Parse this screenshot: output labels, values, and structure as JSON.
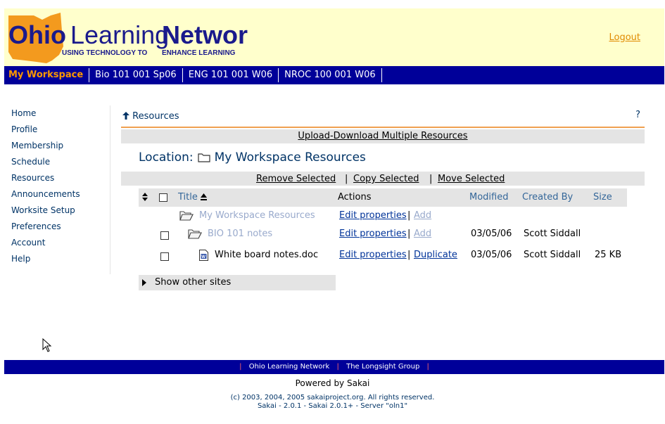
{
  "header": {
    "logo": {
      "ohio": "Ohio",
      "learning": "Learning",
      "network": "Network",
      "tagline_left": "USING TECHNOLOGY TO",
      "tagline_right": "ENHANCE LEARNING"
    },
    "logout": "Logout"
  },
  "sitenav": {
    "tabs": [
      {
        "label": "My Workspace",
        "selected": true
      },
      {
        "label": "Bio 101 001 Sp06",
        "selected": false
      },
      {
        "label": "ENG 101 001 W06",
        "selected": false
      },
      {
        "label": "NROC 100 001 W06",
        "selected": false
      }
    ]
  },
  "toolmenu": {
    "items": [
      {
        "label": "Home"
      },
      {
        "label": "Profile"
      },
      {
        "label": "Membership"
      },
      {
        "label": "Schedule"
      },
      {
        "label": "Resources"
      },
      {
        "label": "Announcements"
      },
      {
        "label": "Worksite Setup"
      },
      {
        "label": "Preferences"
      },
      {
        "label": "Account"
      },
      {
        "label": "Help"
      }
    ]
  },
  "tool": {
    "title": "Resources",
    "help": "?",
    "upload_label": "Upload-Download Multiple Resources",
    "location_label": "Location:",
    "location_value": "My Workspace Resources",
    "actions": {
      "remove": "Remove Selected",
      "copy": "Copy Selected",
      "move": "Move Selected",
      "separator": "|"
    },
    "columns": {
      "title": "Title",
      "actions": "Actions",
      "modified": "Modified",
      "created_by": "Created By",
      "size": "Size"
    },
    "rows": [
      {
        "title": "My Workspace Resources",
        "edit": "Edit properties",
        "sep": "|",
        "second": "Add",
        "modified": "",
        "created_by": "",
        "size": ""
      },
      {
        "title": "BIO 101 notes",
        "edit": "Edit properties",
        "sep": "|",
        "second": "Add",
        "modified": "03/05/06",
        "created_by": "Scott Siddall",
        "size": ""
      },
      {
        "title": "White board notes.doc",
        "edit": "Edit properties",
        "sep": "|",
        "second": "Duplicate",
        "modified": "03/05/06",
        "created_by": "Scott Siddall",
        "size": "25 KB"
      }
    ],
    "other_sites": "Show other sites"
  },
  "footer": {
    "links": [
      "Ohio Learning Network",
      "The Longsight Group"
    ],
    "separator": "|",
    "powered_by": "Powered by Sakai",
    "copyright_line1": "(c) 2003, 2004, 2005 sakaiproject.org. All rights reserved.",
    "copyright_line2": "Sakai - 2.0.1 - Sakai 2.0.1+ - Server \"oln1\""
  },
  "colors": {
    "nav_blue": "#000099",
    "header_yellow": "#ffffcc",
    "accent_orange": "#ff9900",
    "link_blue": "#003399"
  }
}
